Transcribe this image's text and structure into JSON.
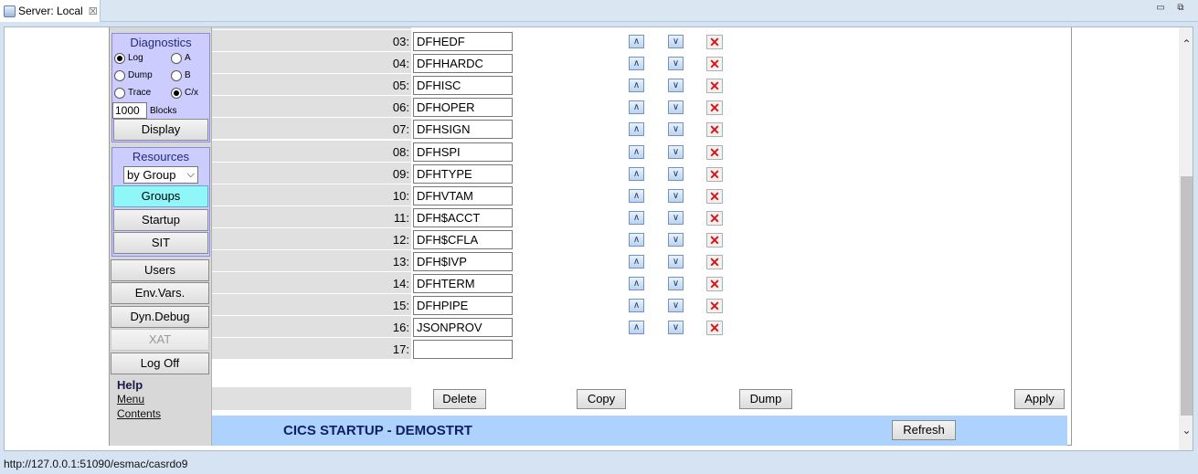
{
  "tab": {
    "title": "Server: Local",
    "close": "☒"
  },
  "window": {
    "minimize": "▭",
    "restore": "⧉"
  },
  "sidebar": {
    "diagnostics": {
      "title": "Diagnostics",
      "radios": [
        {
          "label": "Log",
          "checked": true
        },
        {
          "label": "A",
          "checked": false
        },
        {
          "label": "Dump",
          "checked": false
        },
        {
          "label": "B",
          "checked": false
        },
        {
          "label": "Trace",
          "checked": false
        },
        {
          "label": "C/x",
          "checked": true
        }
      ],
      "blocks_value": "1000",
      "blocks_label": "Blocks",
      "display_button": "Display"
    },
    "resources": {
      "title": "Resources",
      "select_value": "by Group",
      "buttons": [
        "Groups",
        "Startup",
        "SIT"
      ]
    },
    "buttons": [
      "Users",
      "Env.Vars.",
      "Dyn.Debug",
      "XAT",
      "Log Off"
    ],
    "help": {
      "title": "Help",
      "links": [
        "Menu",
        "Contents"
      ]
    }
  },
  "rows": [
    {
      "num": "03:",
      "value": "DFHEDF"
    },
    {
      "num": "04:",
      "value": "DFHHARDC"
    },
    {
      "num": "05:",
      "value": "DFHISC"
    },
    {
      "num": "06:",
      "value": "DFHOPER"
    },
    {
      "num": "07:",
      "value": "DFHSIGN"
    },
    {
      "num": "08:",
      "value": "DFHSPI"
    },
    {
      "num": "09:",
      "value": "DFHTYPE"
    },
    {
      "num": "10:",
      "value": "DFHVTAM"
    },
    {
      "num": "11:",
      "value": "DFH$ACCT"
    },
    {
      "num": "12:",
      "value": "DFH$CFLA"
    },
    {
      "num": "13:",
      "value": "DFH$IVP"
    },
    {
      "num": "14:",
      "value": "DFHTERM"
    },
    {
      "num": "15:",
      "value": "DFHPIPE"
    },
    {
      "num": "16:",
      "value": "JSONPROV"
    },
    {
      "num": "17:",
      "value": ""
    }
  ],
  "actions": {
    "delete": "Delete",
    "copy": "Copy",
    "dump": "Dump",
    "apply": "Apply"
  },
  "banner": {
    "title": "CICS STARTUP - DEMOSTRT",
    "refresh": "Refresh"
  },
  "footer_id": "casrdo97: p 999159",
  "status_url": "http://127.0.0.1:51090/esmac/casrdo9"
}
